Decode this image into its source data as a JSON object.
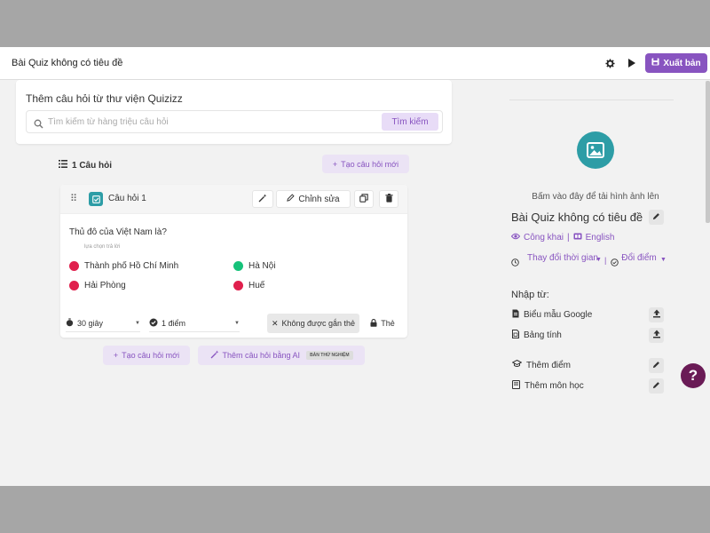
{
  "header": {
    "title": "Bài Quiz không có tiêu đề",
    "publish_label": "Xuất bản",
    "icons": [
      "gear-icon",
      "play-icon",
      "save-icon"
    ]
  },
  "library": {
    "title": "Thêm câu hỏi từ thư viện Quizizz",
    "search_placeholder": "Tìm kiếm từ hàng triệu câu hỏi",
    "search_button": "Tìm kiếm"
  },
  "question_list": {
    "count_label": "1 Câu hỏi",
    "new_question_label": "Tạo câu hỏi mới"
  },
  "question": {
    "label": "Câu hỏi 1",
    "edit_label": "Chỉnh sửa",
    "text": "Thủ đô của Việt Nam là?",
    "answer_hint": "lựa chọn trả lời",
    "answers": [
      {
        "text": "Thành phố Hồ Chí Minh",
        "correct": false
      },
      {
        "text": "Hà Nội",
        "correct": true
      },
      {
        "text": "Hải Phòng",
        "correct": false
      },
      {
        "text": "Huế",
        "correct": false
      }
    ],
    "time_label": "30 giây",
    "points_label": "1 điểm",
    "untagged_label": "Không được gắn thẻ",
    "tag_label": "Thẻ"
  },
  "bottom_actions": {
    "new_question": "Tạo câu hỏi mới",
    "ai_question": "Thêm câu hỏi bằng AI",
    "beta": "BẢN THỬ NGHIỆM"
  },
  "side_panel": {
    "upload_text": "Bấm vào đây để tải hình ảnh lên",
    "title": "Bài Quiz không có tiêu đề",
    "visibility": "Công khai",
    "language": "English",
    "change_time": "Thay đổi thời gian",
    "change_points": "Đổi điểm",
    "import_title": "Nhập từ:",
    "import_items": [
      "Biểu mẫu Google",
      "Bảng tính"
    ],
    "add_points": "Thêm điểm",
    "add_subject": "Thêm môn học"
  },
  "colors": {
    "accent": "#8854c0",
    "teal": "#2d9da6",
    "correct": "#16c27a",
    "incorrect": "#e0204d",
    "help": "#6a1b56"
  }
}
